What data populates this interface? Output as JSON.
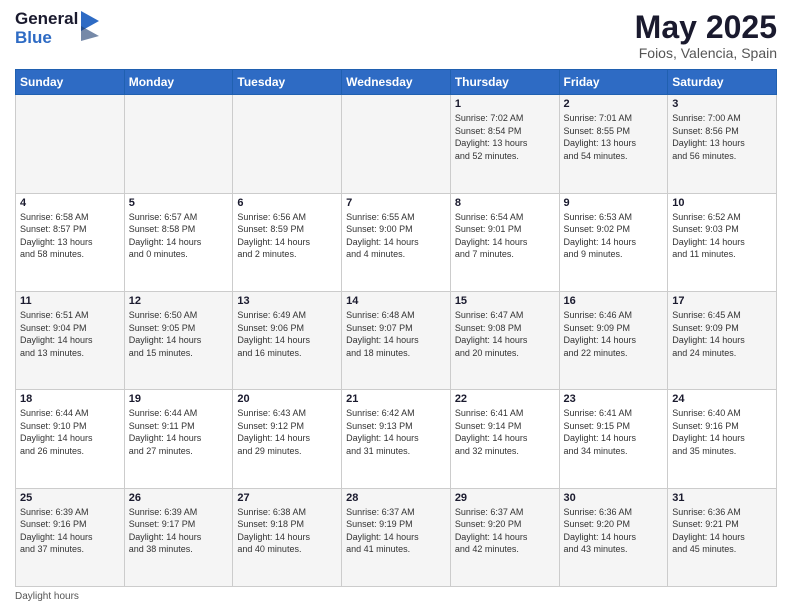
{
  "header": {
    "logo_line1": "General",
    "logo_line2": "Blue",
    "month_title": "May 2025",
    "subtitle": "Foios, Valencia, Spain"
  },
  "days_of_week": [
    "Sunday",
    "Monday",
    "Tuesday",
    "Wednesday",
    "Thursday",
    "Friday",
    "Saturday"
  ],
  "weeks": [
    [
      {
        "day": "",
        "info": ""
      },
      {
        "day": "",
        "info": ""
      },
      {
        "day": "",
        "info": ""
      },
      {
        "day": "",
        "info": ""
      },
      {
        "day": "1",
        "info": "Sunrise: 7:02 AM\nSunset: 8:54 PM\nDaylight: 13 hours\nand 52 minutes."
      },
      {
        "day": "2",
        "info": "Sunrise: 7:01 AM\nSunset: 8:55 PM\nDaylight: 13 hours\nand 54 minutes."
      },
      {
        "day": "3",
        "info": "Sunrise: 7:00 AM\nSunset: 8:56 PM\nDaylight: 13 hours\nand 56 minutes."
      }
    ],
    [
      {
        "day": "4",
        "info": "Sunrise: 6:58 AM\nSunset: 8:57 PM\nDaylight: 13 hours\nand 58 minutes."
      },
      {
        "day": "5",
        "info": "Sunrise: 6:57 AM\nSunset: 8:58 PM\nDaylight: 14 hours\nand 0 minutes."
      },
      {
        "day": "6",
        "info": "Sunrise: 6:56 AM\nSunset: 8:59 PM\nDaylight: 14 hours\nand 2 minutes."
      },
      {
        "day": "7",
        "info": "Sunrise: 6:55 AM\nSunset: 9:00 PM\nDaylight: 14 hours\nand 4 minutes."
      },
      {
        "day": "8",
        "info": "Sunrise: 6:54 AM\nSunset: 9:01 PM\nDaylight: 14 hours\nand 7 minutes."
      },
      {
        "day": "9",
        "info": "Sunrise: 6:53 AM\nSunset: 9:02 PM\nDaylight: 14 hours\nand 9 minutes."
      },
      {
        "day": "10",
        "info": "Sunrise: 6:52 AM\nSunset: 9:03 PM\nDaylight: 14 hours\nand 11 minutes."
      }
    ],
    [
      {
        "day": "11",
        "info": "Sunrise: 6:51 AM\nSunset: 9:04 PM\nDaylight: 14 hours\nand 13 minutes."
      },
      {
        "day": "12",
        "info": "Sunrise: 6:50 AM\nSunset: 9:05 PM\nDaylight: 14 hours\nand 15 minutes."
      },
      {
        "day": "13",
        "info": "Sunrise: 6:49 AM\nSunset: 9:06 PM\nDaylight: 14 hours\nand 16 minutes."
      },
      {
        "day": "14",
        "info": "Sunrise: 6:48 AM\nSunset: 9:07 PM\nDaylight: 14 hours\nand 18 minutes."
      },
      {
        "day": "15",
        "info": "Sunrise: 6:47 AM\nSunset: 9:08 PM\nDaylight: 14 hours\nand 20 minutes."
      },
      {
        "day": "16",
        "info": "Sunrise: 6:46 AM\nSunset: 9:09 PM\nDaylight: 14 hours\nand 22 minutes."
      },
      {
        "day": "17",
        "info": "Sunrise: 6:45 AM\nSunset: 9:09 PM\nDaylight: 14 hours\nand 24 minutes."
      }
    ],
    [
      {
        "day": "18",
        "info": "Sunrise: 6:44 AM\nSunset: 9:10 PM\nDaylight: 14 hours\nand 26 minutes."
      },
      {
        "day": "19",
        "info": "Sunrise: 6:44 AM\nSunset: 9:11 PM\nDaylight: 14 hours\nand 27 minutes."
      },
      {
        "day": "20",
        "info": "Sunrise: 6:43 AM\nSunset: 9:12 PM\nDaylight: 14 hours\nand 29 minutes."
      },
      {
        "day": "21",
        "info": "Sunrise: 6:42 AM\nSunset: 9:13 PM\nDaylight: 14 hours\nand 31 minutes."
      },
      {
        "day": "22",
        "info": "Sunrise: 6:41 AM\nSunset: 9:14 PM\nDaylight: 14 hours\nand 32 minutes."
      },
      {
        "day": "23",
        "info": "Sunrise: 6:41 AM\nSunset: 9:15 PM\nDaylight: 14 hours\nand 34 minutes."
      },
      {
        "day": "24",
        "info": "Sunrise: 6:40 AM\nSunset: 9:16 PM\nDaylight: 14 hours\nand 35 minutes."
      }
    ],
    [
      {
        "day": "25",
        "info": "Sunrise: 6:39 AM\nSunset: 9:16 PM\nDaylight: 14 hours\nand 37 minutes."
      },
      {
        "day": "26",
        "info": "Sunrise: 6:39 AM\nSunset: 9:17 PM\nDaylight: 14 hours\nand 38 minutes."
      },
      {
        "day": "27",
        "info": "Sunrise: 6:38 AM\nSunset: 9:18 PM\nDaylight: 14 hours\nand 40 minutes."
      },
      {
        "day": "28",
        "info": "Sunrise: 6:37 AM\nSunset: 9:19 PM\nDaylight: 14 hours\nand 41 minutes."
      },
      {
        "day": "29",
        "info": "Sunrise: 6:37 AM\nSunset: 9:20 PM\nDaylight: 14 hours\nand 42 minutes."
      },
      {
        "day": "30",
        "info": "Sunrise: 6:36 AM\nSunset: 9:20 PM\nDaylight: 14 hours\nand 43 minutes."
      },
      {
        "day": "31",
        "info": "Sunrise: 6:36 AM\nSunset: 9:21 PM\nDaylight: 14 hours\nand 45 minutes."
      }
    ]
  ],
  "footer": {
    "label": "Daylight hours"
  }
}
